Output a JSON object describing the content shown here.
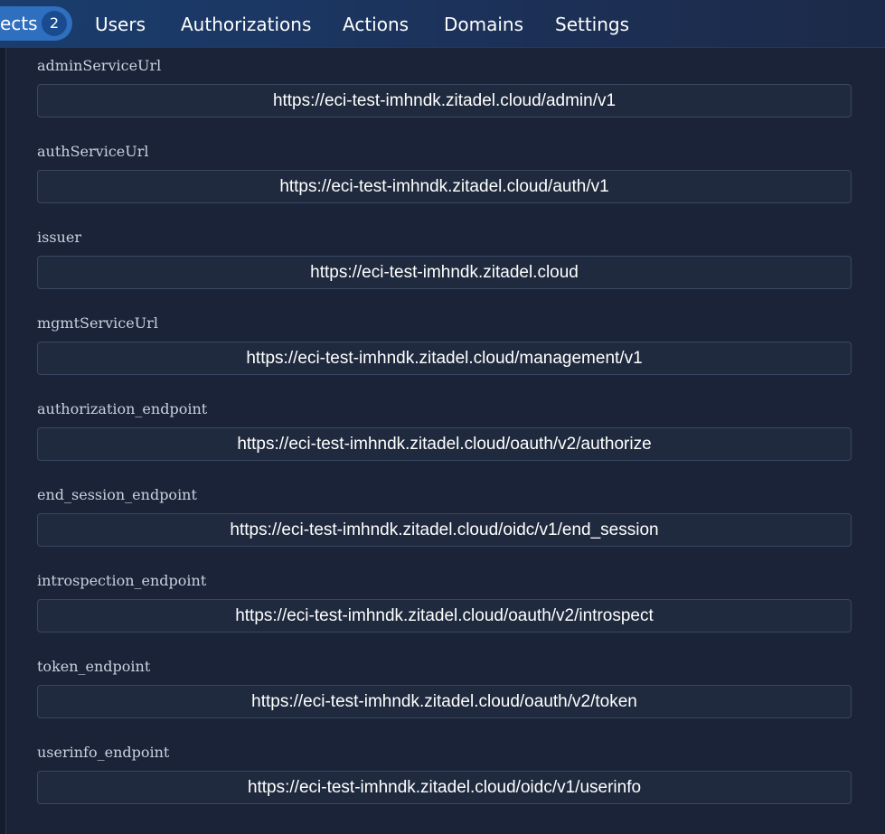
{
  "nav": {
    "active": {
      "label": "ects",
      "badge": "2"
    },
    "items": [
      {
        "label": "Users"
      },
      {
        "label": "Authorizations"
      },
      {
        "label": "Actions"
      },
      {
        "label": "Domains"
      },
      {
        "label": "Settings"
      }
    ]
  },
  "fields": [
    {
      "label": "adminServiceUrl",
      "value": "https://eci-test-imhndk.zitadel.cloud/admin/v1"
    },
    {
      "label": "authServiceUrl",
      "value": "https://eci-test-imhndk.zitadel.cloud/auth/v1"
    },
    {
      "label": "issuer",
      "value": "https://eci-test-imhndk.zitadel.cloud"
    },
    {
      "label": "mgmtServiceUrl",
      "value": "https://eci-test-imhndk.zitadel.cloud/management/v1"
    },
    {
      "label": "authorization_endpoint",
      "value": "https://eci-test-imhndk.zitadel.cloud/oauth/v2/authorize"
    },
    {
      "label": "end_session_endpoint",
      "value": "https://eci-test-imhndk.zitadel.cloud/oidc/v1/end_session"
    },
    {
      "label": "introspection_endpoint",
      "value": "https://eci-test-imhndk.zitadel.cloud/oauth/v2/introspect"
    },
    {
      "label": "token_endpoint",
      "value": "https://eci-test-imhndk.zitadel.cloud/oauth/v2/token"
    },
    {
      "label": "userinfo_endpoint",
      "value": "https://eci-test-imhndk.zitadel.cloud/oidc/v1/userinfo"
    }
  ]
}
